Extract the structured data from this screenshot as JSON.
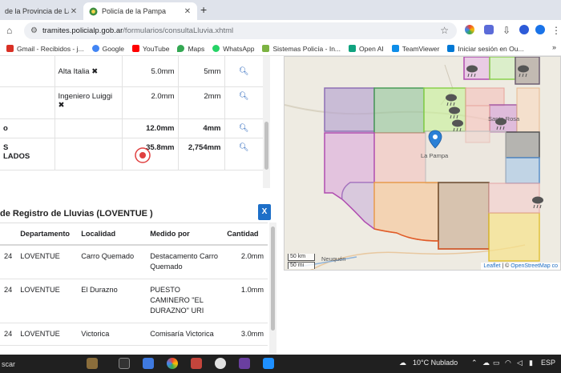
{
  "browser": {
    "tabs": [
      {
        "title": "de la Provincia de La Pam",
        "active": false
      },
      {
        "title": "Policía de la Pampa",
        "active": true
      }
    ],
    "url_host": "tramites.policialp.gob.ar",
    "url_path": "/formularios/consultaLluvia.xhtml",
    "bookmarks": [
      {
        "label": "Gmail - Recibidos - j...",
        "icon_color": "#d93025"
      },
      {
        "label": "Google",
        "icon_color": "#4285f4"
      },
      {
        "label": "YouTube",
        "icon_color": "#ff0000"
      },
      {
        "label": "Maps",
        "icon_color": "#34a853"
      },
      {
        "label": "WhatsApp",
        "icon_color": "#25d366"
      },
      {
        "label": "Sistemas Policía - In...",
        "icon_color": "#7cb342"
      },
      {
        "label": "Open AI",
        "icon_color": "#10a37f"
      },
      {
        "label": "TeamViewer",
        "icon_color": "#0e8ee9"
      },
      {
        "label": "Iniciar sesión en Ou...",
        "icon_color": "#0078d4"
      }
    ],
    "bookmarks_more": "»"
  },
  "top_table": {
    "rows": [
      {
        "localidad": "Alta Italia",
        "v1": "5.0mm",
        "v2": "5mm"
      },
      {
        "localidad": "Ingeniero Luiggi",
        "v1": "2.0mm",
        "v2": "2mm"
      },
      {
        "label": "o",
        "v1": "12.0mm",
        "v2": "4mm"
      },
      {
        "label": "S",
        "label2": "LADOS",
        "v1": "35.8mm",
        "v2": "2,754mm"
      }
    ]
  },
  "section": {
    "title": "de Registro de Lluvias (LOVENTUE )",
    "excel_label": "X"
  },
  "lower_table": {
    "headers": [
      "Departamento",
      "Localidad",
      "Medido por",
      "Cantidad"
    ],
    "rows": [
      {
        "year": "24",
        "departamento": "LOVENTUE",
        "localidad": "Carro Quemado",
        "medido": "Destacamento Carro Quemado",
        "cantidad": "2.0mm"
      },
      {
        "year": "24",
        "departamento": "LOVENTUE",
        "localidad": "El Durazno",
        "medido": "PUESTO CAMINERO \"EL DURAZNO\" URI",
        "cantidad": "1.0mm"
      },
      {
        "year": "24",
        "departamento": "LOVENTUE",
        "localidad": "Victorica",
        "medido": "Comisaría Victorica",
        "cantidad": "3.0mm"
      }
    ]
  },
  "map": {
    "city_main": "La Pampa",
    "city_ne": "Santa Rosa",
    "city_sw": "Neuquén",
    "scale_km": "50 km",
    "scale_mi": "50 mi",
    "attrib_leaflet": "Leaflet",
    "attrib_sep": " | © ",
    "attrib_osm": "OpenStreetMap co"
  },
  "taskbar": {
    "search_label": "scar",
    "weather": "10°C  Nublado",
    "language": "ESP"
  }
}
